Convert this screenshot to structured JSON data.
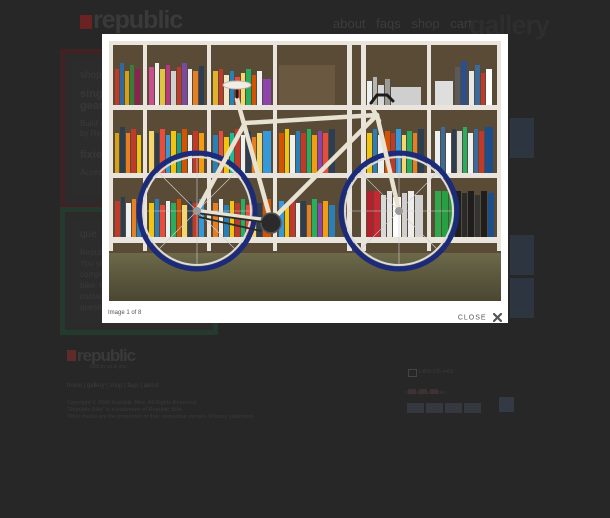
{
  "site": {
    "logo": "republic",
    "tagline": "built by us & you"
  },
  "nav": {
    "items": [
      "about",
      "faqs",
      "shop",
      "cart"
    ]
  },
  "page_title": "gallery",
  "sidebar": {
    "shop_box": {
      "heading": "shop",
      "product_line1": "singl",
      "product_line2": "gear",
      "desc_line1": "Build a",
      "desc_line2": "by Rep",
      "fixie": "fixie",
      "access": "Access"
    },
    "questions_box": {
      "heading": "que",
      "lines": [
        "Republ",
        "You se",
        "compo",
        "bike. P",
        "contac",
        "questi"
      ]
    }
  },
  "footer": {
    "links": "home | gallery | shop | faqs | about",
    "copyright_lines": [
      "Copyright © 2008 Republic Bike. All Rights Reserved.",
      "\"Republic Bike\" is a trademark of Republic Bike.",
      "Other marks are the properties of their respective owners. Privacy statement."
    ],
    "phone": "1-800-335-4402",
    "shipping": "shipping available:",
    "seal": "GeoTrust"
  },
  "lightbox": {
    "caption": "Image 1 of 8",
    "close_label": "CLOSE",
    "photo_icon": "fixie-bicycle-photo"
  },
  "colors": {
    "overlay": "#272727",
    "accent_red": "#6a2222",
    "modal_bg": "#ffffff"
  }
}
